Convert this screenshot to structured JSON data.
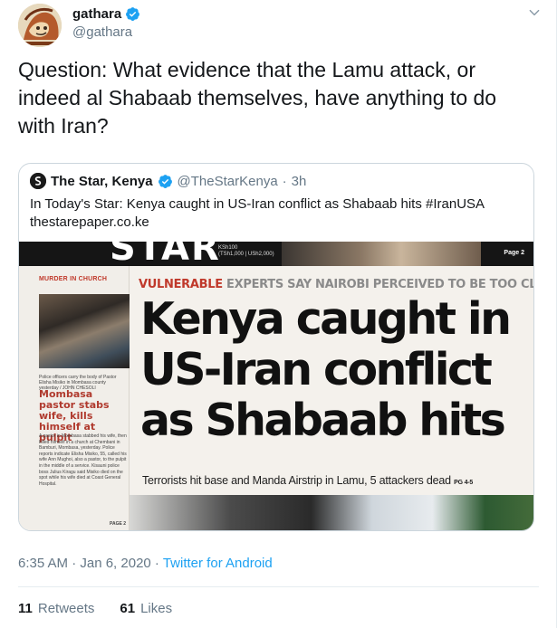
{
  "author": {
    "display_name": "gathara",
    "handle": "@gathara",
    "verified": true,
    "menu_icon": "chevron-down-icon"
  },
  "tweet": {
    "text": "Question: What evidence that the Lamu attack, or indeed al Shabaab themselves, have anything to do with Iran?"
  },
  "quoted": {
    "display_name": "The Star, Kenya",
    "handle": "@TheStarKenya",
    "separator": "·",
    "time": "3h",
    "text_line1": "In Today's Star: Kenya caught in US-Iran conflict as Shabaab hits #IranUSA",
    "text_line2": "thestarepaper.co.ke",
    "image": {
      "masthead_letters": "STAR",
      "price_line1": "KSh100",
      "price_line2": "(TSh1,000 | USh2,000)",
      "page_label": "Page 2",
      "side_label": "MURDER IN CHURCH",
      "side_caption": "Police officers carry the body of Pastor Elisha Misiko in Mombasa county yesterday / JOHN CHESOLI",
      "side_headline": "Mombasa pastor stabs wife, kills himself at pulpit",
      "side_body": "A pastor in Mombasa stabbed his wife, then killed himself in a church at Chembani in Bamburi, Mombasa, yesterday. Police reports indicate Elisha Misiko, 55, called his wife Ann Mughoi, also a pastor, to the pulpit in the middle of a service. Kisauni police boss Julius Kiragu said Misiko died on the spot while his wife died at Coast General Hospital.",
      "side_page": "PAGE 2",
      "kicker_red": "VULNERABLE",
      "kicker_grey": "EXPERTS SAY NAIROBI PERCEIVED TO BE TOO CLOSE TO WASHINGTON",
      "headline_line1": "Kenya caught in",
      "headline_line2": "US-Iran conflict",
      "headline_line3": "as Shabaab hits",
      "subhead": "Terrorists hit base and Manda Airstrip in Lamu, 5 attackers dead",
      "subhead_pages": "PG 4-5"
    }
  },
  "meta": {
    "timestamp": "6:35 AM · Jan 6, 2020 ·",
    "source": "Twitter for Android"
  },
  "stats": {
    "retweets_count": "11",
    "retweets_label": "Retweets",
    "likes_count": "61",
    "likes_label": "Likes"
  },
  "colors": {
    "verified_blue": "#1da1f2",
    "secondary_text": "#657786",
    "kicker_red": "#c0392b"
  }
}
